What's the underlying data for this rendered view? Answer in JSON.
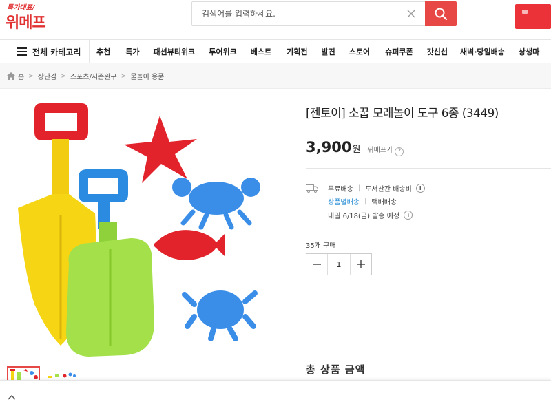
{
  "header": {
    "logo_tag": "특가대표/",
    "logo_main": "위메프",
    "search_placeholder": "검색어를 입력하세요.",
    "clear_icon": "close-icon",
    "search_icon": "search-icon",
    "accent_color": "#e74845"
  },
  "nav": {
    "category_label": "전체 카테고리",
    "menu_items": [
      "추천",
      "특가",
      "패션뷰티위크",
      "투어위크",
      "베스트",
      "기획전",
      "발견",
      "스토어",
      "슈퍼쿠폰",
      "갓신선",
      "새벽·당일배송",
      "상생마"
    ]
  },
  "breadcrumb": [
    "홈",
    "장난감",
    "스포츠/시즌완구",
    "물놀이 용품"
  ],
  "product": {
    "title": "[젠토이] 소꿉 모래놀이 도구 6종 (3449)",
    "price": "3,900",
    "currency": "원",
    "price_tag": "위메프가",
    "price_help": "?",
    "shipping": {
      "free": "무료배송",
      "island": "도서산간 배송비",
      "type_link": "상품별배송",
      "type": "택배배송",
      "delivery": "내일 6/18(금) 발송 예정",
      "info_symbol": "i"
    },
    "buy_count": "35개 구매",
    "quantity": "1",
    "total_label": "총 상품 금액"
  }
}
